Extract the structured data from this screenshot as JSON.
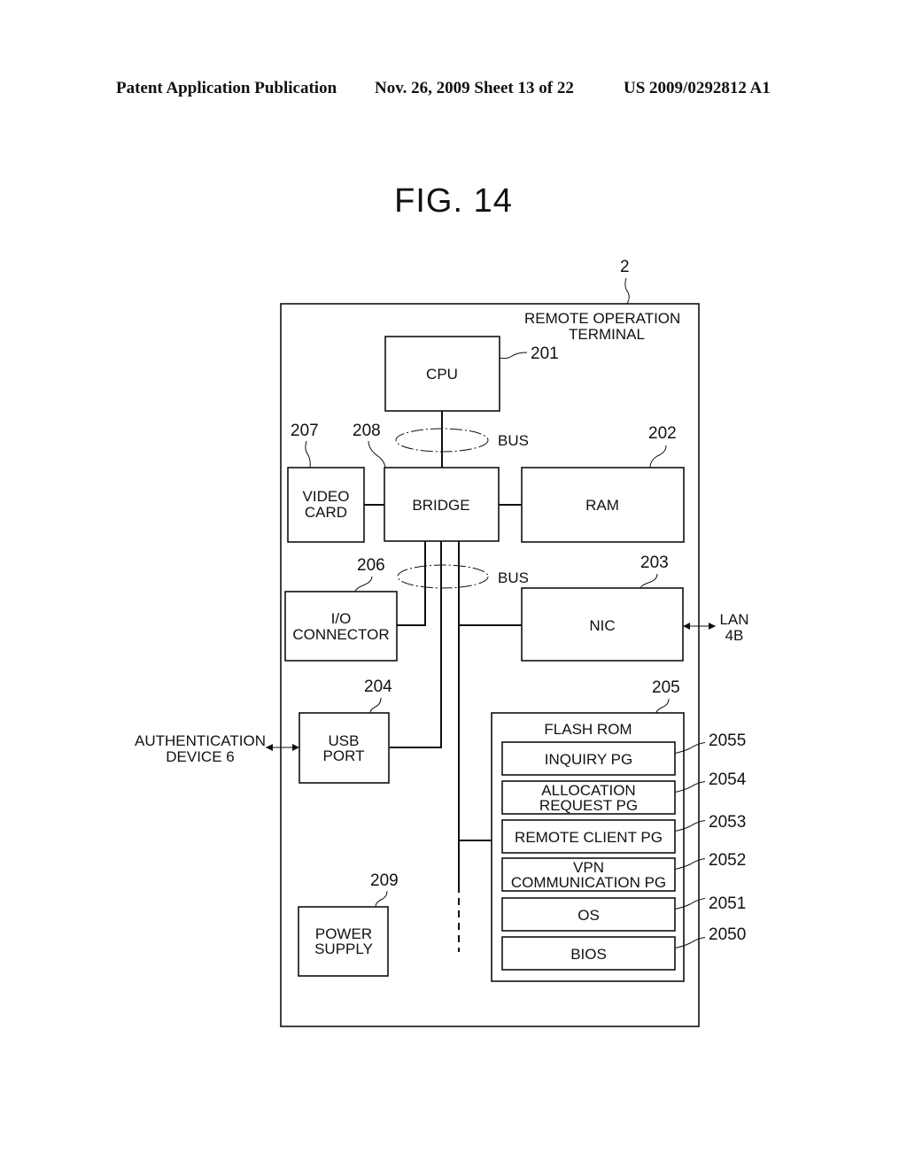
{
  "header": {
    "left": "Patent Application Publication",
    "date_sheet": "Nov. 26, 2009   Sheet 13 of 22",
    "pub_number": "US 2009/0292812 A1"
  },
  "figure": {
    "title": "FIG. 14",
    "terminal": {
      "ref": "2",
      "line1": "REMOTE  OPERATION",
      "line2": "TERMINAL"
    },
    "blocks": {
      "cpu": {
        "ref": "201",
        "label": "CPU"
      },
      "ram": {
        "ref": "202",
        "label": "RAM"
      },
      "nic": {
        "ref": "203",
        "label": "NIC"
      },
      "usb": {
        "ref": "204",
        "line1": "USB",
        "line2": "PORT"
      },
      "io": {
        "ref": "206",
        "line1": "I/O",
        "line2": "CONNECTOR"
      },
      "video": {
        "ref": "207",
        "line1": "VIDEO",
        "line2": "CARD"
      },
      "bridge": {
        "ref": "208",
        "label": "BRIDGE"
      },
      "power": {
        "ref": "209",
        "line1": "POWER",
        "line2": "SUPPLY"
      }
    },
    "bus_label_1": "BUS",
    "bus_label_2": "BUS",
    "flash": {
      "ref": "205",
      "label": "FLASH  ROM",
      "items": [
        {
          "ref": "2055",
          "line1": "INQUIRY  PG",
          "line2": ""
        },
        {
          "ref": "2054",
          "line1": "ALLOCATION",
          "line2": "REQUEST  PG"
        },
        {
          "ref": "2053",
          "line1": "REMOTE  CLIENT  PG",
          "line2": ""
        },
        {
          "ref": "2052",
          "line1": "VPN",
          "line2": "COMMUNICATION  PG"
        },
        {
          "ref": "2051",
          "line1": "OS",
          "line2": ""
        },
        {
          "ref": "2050",
          "line1": "BIOS",
          "line2": ""
        }
      ]
    },
    "lan": {
      "line1": "LAN",
      "line2": "4B"
    },
    "auth": {
      "line1": "AUTHENTICATION",
      "line2": "DEVICE  6"
    }
  }
}
